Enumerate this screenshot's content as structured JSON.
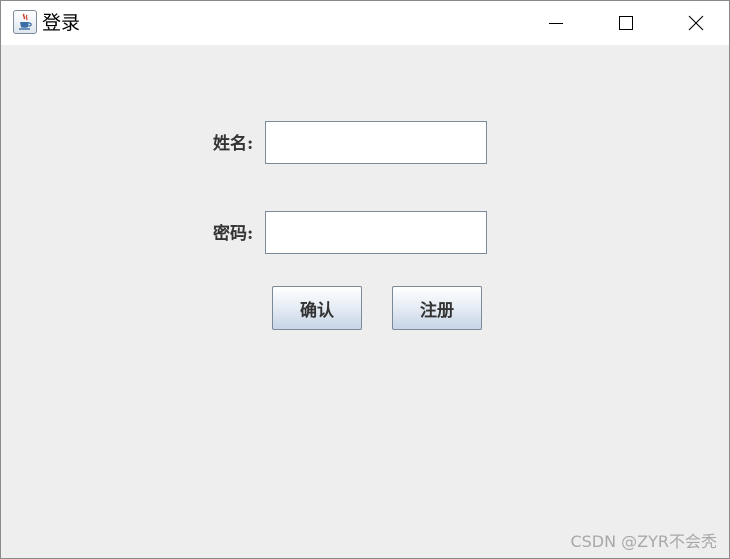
{
  "window": {
    "title": "登录",
    "icon": "java-cup-icon",
    "controls": {
      "minimize": "minimize-icon",
      "maximize": "maximize-icon",
      "close": "close-icon"
    }
  },
  "form": {
    "name_label": "姓名:",
    "name_value": "",
    "password_label": "密码:",
    "password_value": "",
    "confirm_label": "确认",
    "register_label": "注册"
  },
  "watermark": "CSDN @ZYR不会秃",
  "colors": {
    "background": "#eeeeee",
    "titlebar": "#ffffff",
    "button_gradient_bottom": "#c7d5e6",
    "field_border": "#7a8a99"
  }
}
